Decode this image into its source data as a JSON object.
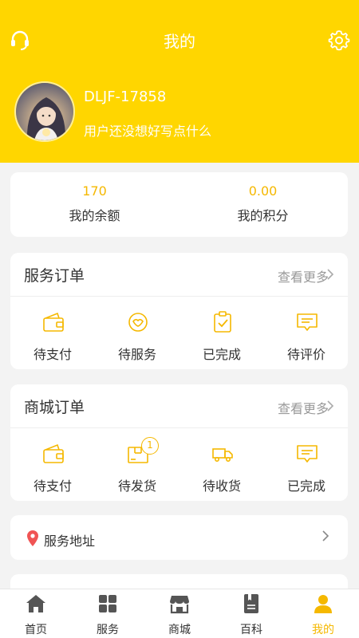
{
  "header": {
    "title": "我的",
    "left_icon": "headset-icon",
    "right_icon": "gear-icon",
    "bg_color": "#ffd600"
  },
  "profile": {
    "username": "DLJF-17858",
    "bio": "用户还没想好写点什么",
    "avatar_icon": "avatar-illustration"
  },
  "wallet": {
    "balance_value": "170",
    "balance_label": "我的余额",
    "points_value": "0.00",
    "points_label": "我的积分"
  },
  "service_orders": {
    "title": "服务订单",
    "more": "查看更多",
    "items": [
      {
        "label": "待支付",
        "icon": "wallet-icon"
      },
      {
        "label": "待服务",
        "icon": "service-badge-icon"
      },
      {
        "label": "已完成",
        "icon": "clipboard-check-icon"
      },
      {
        "label": "待评价",
        "icon": "comment-icon"
      }
    ]
  },
  "shop_orders": {
    "title": "商城订单",
    "more": "查看更多",
    "items": [
      {
        "label": "待支付",
        "icon": "wallet-icon"
      },
      {
        "label": "待发货",
        "icon": "package-icon",
        "badge": "1"
      },
      {
        "label": "待收货",
        "icon": "truck-icon"
      },
      {
        "label": "已完成",
        "icon": "comment-icon"
      }
    ]
  },
  "address": {
    "label": "服务地址",
    "icon": "location-pin-icon"
  },
  "tabs": [
    {
      "label": "首页",
      "icon": "home-icon"
    },
    {
      "label": "服务",
      "icon": "grid-icon"
    },
    {
      "label": "商城",
      "icon": "store-icon"
    },
    {
      "label": "百科",
      "icon": "book-icon"
    },
    {
      "label": "我的",
      "icon": "user-icon",
      "active": true
    }
  ],
  "colors": {
    "accent": "#f5b800",
    "primary": "#ffd600",
    "pin": "#f05454"
  }
}
